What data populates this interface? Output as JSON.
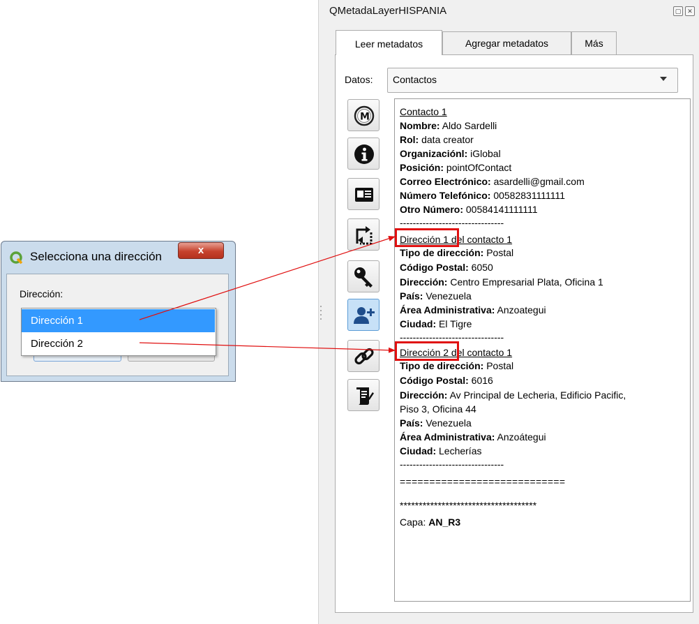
{
  "panel": {
    "title": "QMetadaLayerHISPANIA",
    "float_icon": "restore-icon",
    "close_icon": "close-icon",
    "tabs": [
      {
        "label": "Leer metadatos",
        "active": true
      },
      {
        "label": "Agregar metadatos",
        "active": false
      },
      {
        "label": "Más",
        "active": false
      }
    ],
    "datos_label": "Datos:",
    "datos_value": "Contactos",
    "tools": [
      {
        "icon": "metadata-m-icon",
        "active": false
      },
      {
        "icon": "info-icon",
        "active": false
      },
      {
        "icon": "id-card-icon",
        "active": false
      },
      {
        "icon": "extent-icon",
        "active": false
      },
      {
        "icon": "key-icon",
        "active": false
      },
      {
        "icon": "add-contact-icon",
        "active": true
      },
      {
        "icon": "link-icon",
        "active": false
      },
      {
        "icon": "license-scroll-icon",
        "active": false
      }
    ],
    "content": {
      "contact_heading": "Contacto 1",
      "nombre_label": "Nombre:",
      "nombre": "Aldo Sardelli",
      "rol_label": "Rol:",
      "rol": "data creator",
      "org_label": "Organizaciónl:",
      "org": "iGlobal",
      "pos_label": "Posición:",
      "pos": "pointOfContact",
      "correo_label": "Correo Electrónico:",
      "correo": "asardelli@gmail.com",
      "tel_label": "Número Telefónico:",
      "tel": "00582831111111",
      "otro_label": "Otro Número:",
      "otro": "00584141111111",
      "separator": "--------------------------------",
      "address1": {
        "heading_a": "Dirección 1",
        "heading_b": " del contacto 1",
        "tipo_label": "Tipo de dirección:",
        "tipo": "Postal",
        "cp_label": "Código Postal:",
        "cp": "6050",
        "dir_label": "Dirección:",
        "dir": "Centro Empresarial Plata, Oficina 1",
        "pais_label": "País:",
        "pais": "Venezuela",
        "area_label": "Área Administrativa:",
        "area": "Anzoategui",
        "ciudad_label": "Ciudad:",
        "ciudad": "El Tigre"
      },
      "address2": {
        "heading_a": "Dirección 2",
        "heading_b": " del contacto 1",
        "tipo_label": "Tipo de dirección:",
        "tipo": "Postal",
        "cp_label": "Código Postal:",
        "cp": "6016",
        "dir_label": "Dirección:",
        "dir_line1": "Av Principal de Lecheria, Edificio Pacific,",
        "dir_line2": "Piso 3, Oficina 44",
        "pais_label": "País:",
        "pais": "Venezuela",
        "area_label": "Área Administrativa:",
        "area": "Anzoátegui",
        "ciudad_label": "Ciudad:",
        "ciudad": "Lecherías"
      },
      "double_rule": "============================",
      "star_rule": "************************************",
      "capa_label": "Capa: ",
      "capa": "AN_R3"
    }
  },
  "dialog": {
    "title": "Selecciona una dirección",
    "close_label": "x",
    "field_label": "Dirección:",
    "options": [
      {
        "label": "Dirección 1",
        "selected": true
      },
      {
        "label": "Dirección 2",
        "selected": false
      }
    ]
  },
  "colors": {
    "highlight": "#e01010",
    "selection": "#3399ff",
    "arrow": "#e01010"
  }
}
